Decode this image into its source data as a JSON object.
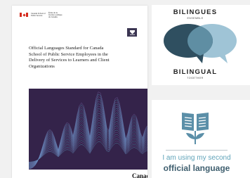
{
  "document_cover": {
    "gov_header_en": "Canada School of Public Service",
    "gov_header_fr": "École de la fonction publique du Canada",
    "title": "Official Languages Standard for Canada School of Public Service Employees in the Delivery of Services to Learners and Client Organizations",
    "wordmark": "Canada"
  },
  "bilingues_logo": {
    "top_word": "BILINGUES",
    "top_sub": "ENSEMBLE",
    "bottom_word": "BILINGUAL",
    "bottom_sub": "TOGETHER",
    "colors": {
      "left_bubble": "#2f4f60",
      "right_bubble": "#9fc4d6"
    }
  },
  "second_language_badge": {
    "line1": "I am using my second",
    "line2": "official language",
    "icon": "book-leaf-icon",
    "colors": {
      "icon": "#5b8fa8",
      "line1": "#5fa3b9",
      "line2": "#3f5f6f"
    }
  }
}
